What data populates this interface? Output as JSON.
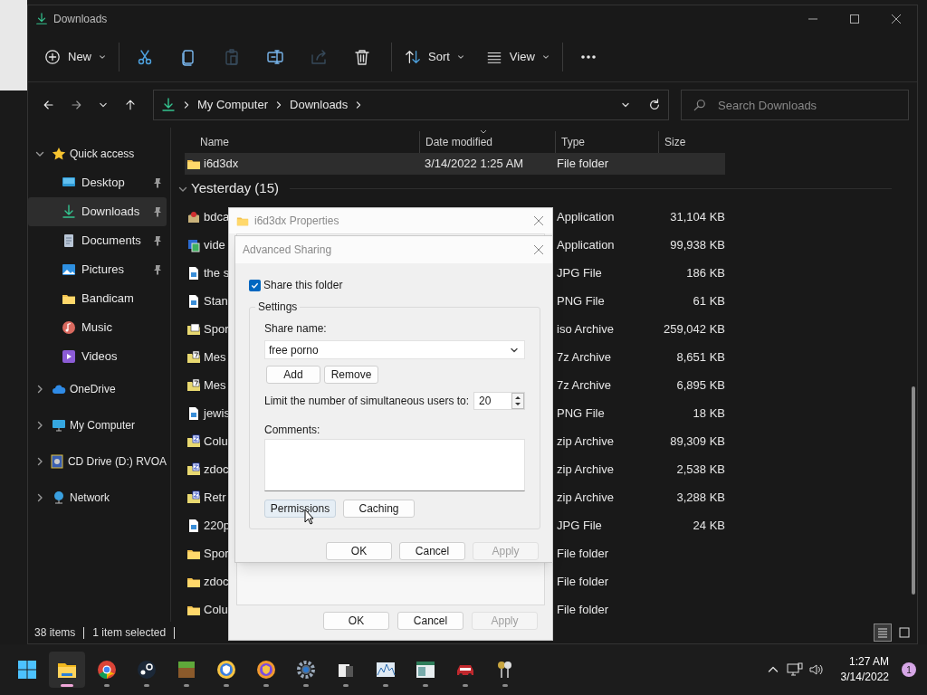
{
  "window": {
    "title": "Downloads"
  },
  "command_bar": {
    "new_label": "New",
    "tools": [
      {
        "kind": "cut",
        "disabled": false
      },
      {
        "kind": "copy",
        "disabled": false
      },
      {
        "kind": "paste",
        "disabled": true
      },
      {
        "kind": "rename",
        "disabled": false
      },
      {
        "kind": "share",
        "disabled": true
      },
      {
        "kind": "delete",
        "disabled": false
      }
    ],
    "sort_label": "Sort",
    "view_label": "View"
  },
  "address_bar": {
    "crumbs": [
      "My Computer",
      "Downloads"
    ]
  },
  "search": {
    "placeholder": "Search Downloads"
  },
  "sidebar": {
    "items": [
      {
        "label": "Quick access",
        "kind": "star",
        "expanded": true,
        "selected": false,
        "children": [
          {
            "label": "Desktop",
            "kind": "desktop",
            "pinned": true,
            "selected": false
          },
          {
            "label": "Downloads",
            "kind": "download",
            "pinned": true,
            "selected": true
          },
          {
            "label": "Documents",
            "kind": "document",
            "pinned": true,
            "selected": false
          },
          {
            "label": "Pictures",
            "kind": "pictures",
            "pinned": true,
            "selected": false
          },
          {
            "label": "Bandicam",
            "kind": "folder",
            "pinned": false,
            "selected": false
          },
          {
            "label": "Music",
            "kind": "music",
            "pinned": false,
            "selected": false
          },
          {
            "label": "Videos",
            "kind": "video",
            "pinned": false,
            "selected": false
          }
        ]
      },
      {
        "label": "OneDrive",
        "kind": "cloud",
        "expanded": false,
        "selected": false
      },
      {
        "label": "My Computer",
        "kind": "computer",
        "expanded": false,
        "selected": false
      },
      {
        "label": "CD Drive (D:) RVOA",
        "kind": "cd",
        "expanded": false,
        "selected": false
      },
      {
        "label": "Network",
        "kind": "network",
        "expanded": false,
        "selected": false
      }
    ]
  },
  "file_list": {
    "columns": [
      {
        "label": "Name",
        "sorted": false
      },
      {
        "label": "Date modified",
        "sorted": true
      },
      {
        "label": "Type",
        "sorted": false
      },
      {
        "label": "Size",
        "sorted": false
      }
    ],
    "rows": [
      {
        "kind": "folder",
        "name": "i6d3dx",
        "date": "3/14/2022 1:25 AM",
        "type": "File folder",
        "selected": true
      }
    ],
    "groups": [
      {
        "label": "Yesterday (15)",
        "expanded": true,
        "rows": [
          {
            "kind": "package",
            "name": "bdca",
            "type": "Application",
            "size": "31,104 KB",
            "selected": false
          },
          {
            "kind": "app",
            "name": "vide",
            "type": "Application",
            "size": "99,938 KB",
            "selected": false
          },
          {
            "kind": "image",
            "name": "the s",
            "type": "JPG File",
            "size": "186 KB",
            "selected": false
          },
          {
            "kind": "image",
            "name": "Stan",
            "type": "PNG File",
            "size": "61 KB",
            "selected": false
          },
          {
            "kind": "iso",
            "name": "Spor",
            "type": "iso Archive",
            "size": "259,042 KB",
            "selected": false
          },
          {
            "kind": "sevenzip",
            "name": "Mes",
            "type": "7z Archive",
            "size": "8,651 KB",
            "selected": false
          },
          {
            "kind": "sevenzip",
            "name": "Mes",
            "type": "7z Archive",
            "size": "6,895 KB",
            "selected": false
          },
          {
            "kind": "image",
            "name": "jewis",
            "type": "PNG File",
            "size": "18 KB",
            "selected": false
          },
          {
            "kind": "zip",
            "name": "Colu",
            "type": "zip Archive",
            "size": "89,309 KB",
            "selected": false
          },
          {
            "kind": "zip",
            "name": "zdoc",
            "type": "zip Archive",
            "size": "2,538 KB",
            "selected": false
          },
          {
            "kind": "zip",
            "name": "Retr",
            "type": "zip Archive",
            "size": "3,288 KB",
            "selected": false
          },
          {
            "kind": "image",
            "name": "220p",
            "type": "JPG File",
            "size": "24 KB",
            "selected": false
          },
          {
            "kind": "folder",
            "name": "Spor",
            "type": "File folder",
            "selected": false
          },
          {
            "kind": "folder",
            "name": "zdoc",
            "type": "File folder",
            "selected": false
          },
          {
            "kind": "folder",
            "name": "Colu",
            "type": "File folder",
            "selected": false
          }
        ]
      }
    ]
  },
  "status_bar": [
    "38 items",
    "1 item selected"
  ],
  "properties_dialog": {
    "title": "i6d3dx Properties",
    "buttons": [
      {
        "label": "OK",
        "disabled": false
      },
      {
        "label": "Cancel",
        "disabled": false
      },
      {
        "label": "Apply",
        "disabled": true
      }
    ]
  },
  "advanced_sharing": {
    "title": "Advanced Sharing",
    "share_checkbox": {
      "label": "Share this folder",
      "checked": true
    },
    "group_label": "Settings",
    "share_name_label": "Share name:",
    "share_name": "free porno",
    "name_buttons": [
      "Add",
      "Remove"
    ],
    "limit_label": "Limit the number of simultaneous users to:",
    "limit_value": "20",
    "comments_label": "Comments:",
    "extra_buttons": [
      {
        "label": "Permissions",
        "hovered": true
      },
      {
        "label": "Caching",
        "hovered": false
      }
    ],
    "buttons": [
      {
        "label": "OK",
        "disabled": false
      },
      {
        "label": "Cancel",
        "disabled": false
      },
      {
        "label": "Apply",
        "disabled": true
      }
    ]
  },
  "taskbar": {
    "apps": [
      {
        "kind": "start",
        "active": false
      },
      {
        "kind": "explorer",
        "active": true
      },
      {
        "kind": "chrome",
        "active": false
      },
      {
        "kind": "steam",
        "active": false
      },
      {
        "kind": "blocks",
        "active": false
      },
      {
        "kind": "shield-browser",
        "active": false
      },
      {
        "kind": "shield-browser-alt",
        "active": false
      },
      {
        "kind": "gear",
        "active": false
      },
      {
        "kind": "files",
        "active": false
      },
      {
        "kind": "chart",
        "active": false
      },
      {
        "kind": "window",
        "active": false
      },
      {
        "kind": "car",
        "active": false
      },
      {
        "kind": "keys",
        "active": false
      }
    ],
    "time": "1:27 AM",
    "date": "3/14/2022",
    "notifications": "1"
  }
}
